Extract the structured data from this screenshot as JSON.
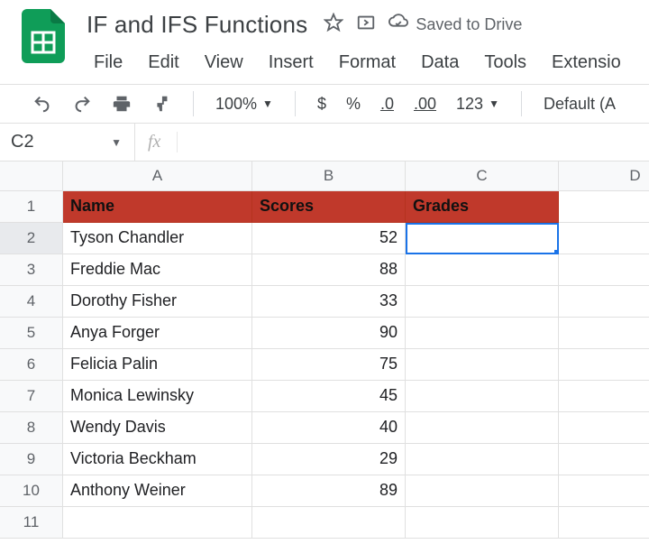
{
  "doc": {
    "title": "IF and IFS Functions",
    "saved_label": "Saved to Drive"
  },
  "menus": [
    "File",
    "Edit",
    "View",
    "Insert",
    "Format",
    "Data",
    "Tools",
    "Extensio"
  ],
  "toolbar": {
    "zoom": "100%",
    "currency": "$",
    "percent": "%",
    "dec_dec": ".0",
    "inc_dec": ".00",
    "num_fmt": "123",
    "font": "Default (A"
  },
  "namebox": {
    "value": "C2"
  },
  "fx": {
    "label": "fx",
    "value": ""
  },
  "columns": [
    "A",
    "B",
    "C",
    "D"
  ],
  "header_row": {
    "name": "Name",
    "scores": "Scores",
    "grades": "Grades"
  },
  "rows": [
    {
      "n": "1"
    },
    {
      "n": "2",
      "name": "Tyson Chandler",
      "score": "52"
    },
    {
      "n": "3",
      "name": "Freddie Mac",
      "score": "88"
    },
    {
      "n": "4",
      "name": "Dorothy Fisher",
      "score": "33"
    },
    {
      "n": "5",
      "name": "Anya Forger",
      "score": "90"
    },
    {
      "n": "6",
      "name": "Felicia Palin",
      "score": "75"
    },
    {
      "n": "7",
      "name": "Monica Lewinsky",
      "score": "45"
    },
    {
      "n": "8",
      "name": "Wendy Davis",
      "score": "40"
    },
    {
      "n": "9",
      "name": "Victoria Beckham",
      "score": "29"
    },
    {
      "n": "10",
      "name": "Anthony Weiner",
      "score": "89"
    },
    {
      "n": "11"
    }
  ],
  "selection": {
    "cell": "C2",
    "row": 2,
    "col": "C"
  }
}
